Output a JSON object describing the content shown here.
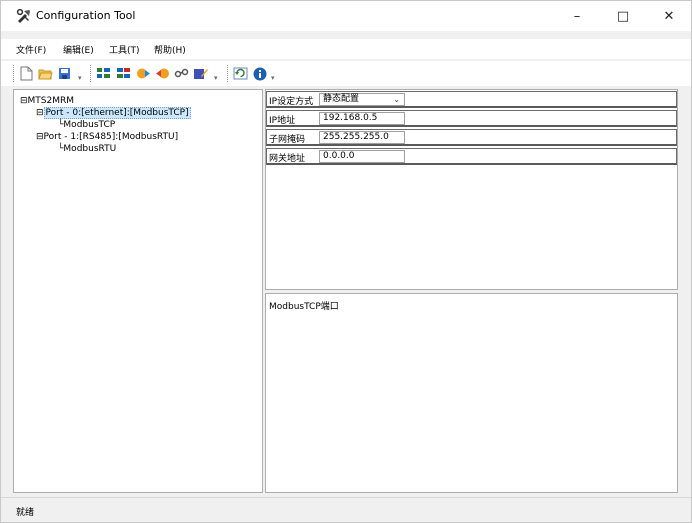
{
  "window": {
    "title": "Configuration Tool",
    "minimize_glyph": "–",
    "maximize_glyph": "□",
    "close_glyph": "✕"
  },
  "menu": [
    {
      "label": "文件(F)"
    },
    {
      "label": "编辑(E)"
    },
    {
      "label": "工具(T)"
    },
    {
      "label": "帮助(H)"
    }
  ],
  "toolbar": {
    "buttons": [
      "new-file-icon",
      "open-folder-icon",
      "save-icon",
      "add-port-icon",
      "add-protocol-icon",
      "download-icon",
      "upload-icon",
      "link-icon",
      "edit-icon",
      "refresh-icon",
      "info-icon"
    ],
    "dropdown_glyph": "▾"
  },
  "tree": {
    "root": "MTS2MRM",
    "port0": "Port - 0:[ethernet]:[ModbusTCP]",
    "port0_child": "ModbusTCP",
    "port1": "Port - 1:[RS485]:[ModbusRTU]",
    "port1_child": "ModbusRTU",
    "expand_glyph": "⊟"
  },
  "properties": [
    {
      "label": "IP设定方式",
      "value": "静态配置",
      "type": "select"
    },
    {
      "label": "IP地址",
      "value": "192.168.0.5",
      "type": "input"
    },
    {
      "label": "子网掩码",
      "value": "255.255.255.0",
      "type": "input"
    },
    {
      "label": "网关地址",
      "value": "0.0.0.0",
      "type": "input"
    }
  ],
  "select_arrow": "⌄",
  "description": "ModbusTCP端口",
  "status": "就绪",
  "colors": {
    "selection_bg": "#cce8ff",
    "info_blue": "#1a5fb4"
  }
}
